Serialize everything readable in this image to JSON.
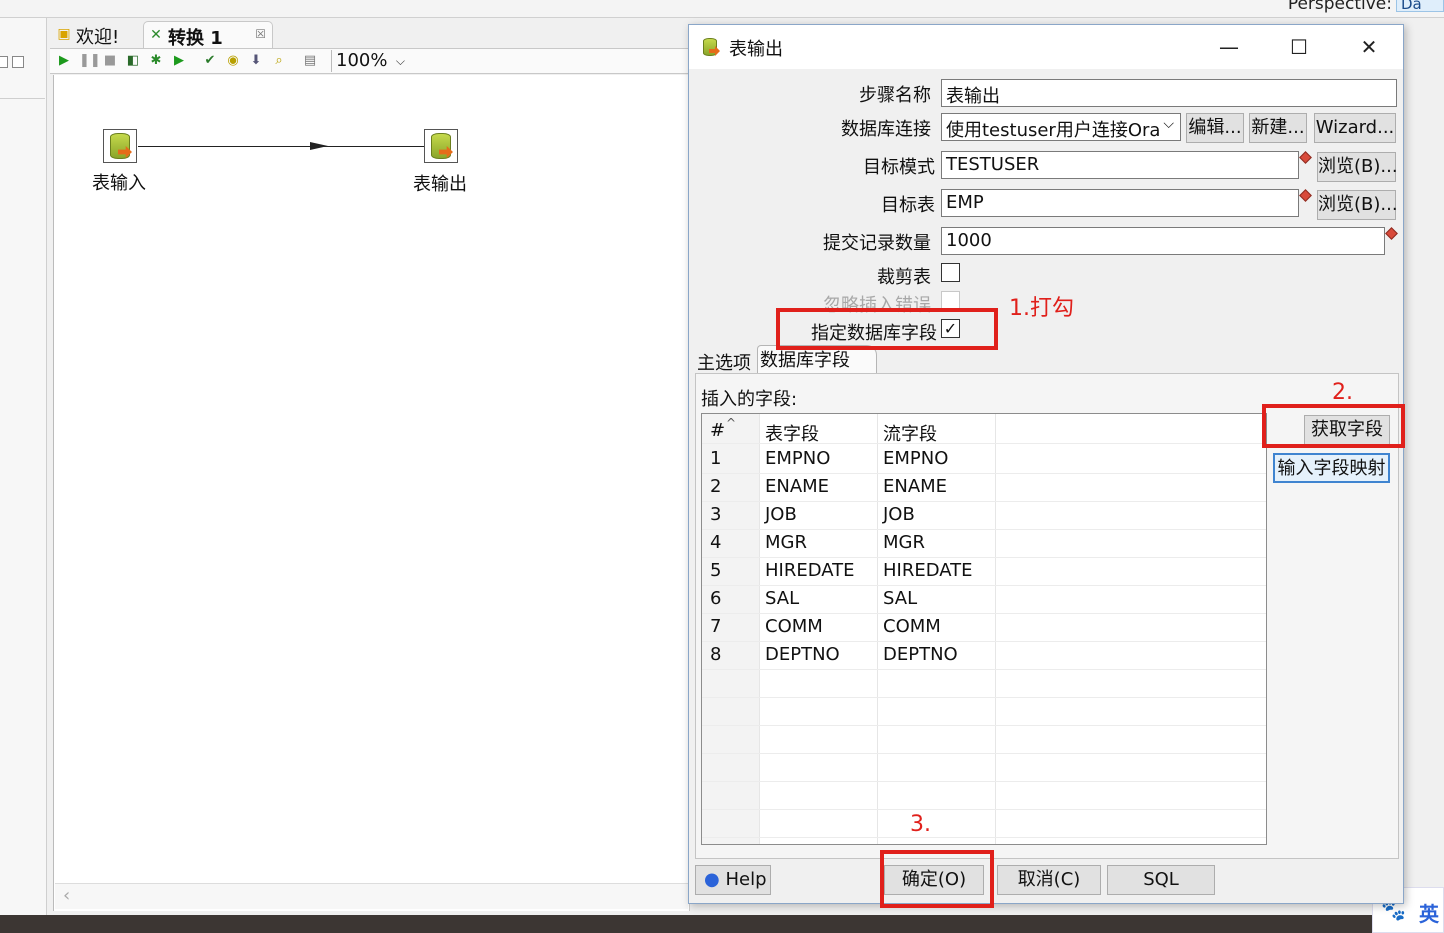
{
  "perspective": {
    "label": "Perspective:",
    "button": "Da"
  },
  "tabs": [
    {
      "label": "欢迎!",
      "icon": "welcome-icon"
    },
    {
      "label": "转换 1",
      "icon": "transformation-icon",
      "close": "☒"
    }
  ],
  "toolbar": {
    "zoom": "100%"
  },
  "canvas": {
    "steps": [
      {
        "label": "表输入",
        "icon": "table-input-icon"
      },
      {
        "label": "表输出",
        "icon": "table-output-icon"
      }
    ]
  },
  "dialog": {
    "title": "表输出",
    "window_controls": {
      "minimize": "—",
      "maximize": "☐",
      "close": "✕"
    },
    "step_name": {
      "label": "步骤名称",
      "value": "表输出"
    },
    "connection": {
      "label": "数据库连接",
      "value": "使用testuser用户连接Ora",
      "edit": "编辑...",
      "new": "新建...",
      "wizard": "Wizard..."
    },
    "target_schema": {
      "label": "目标模式",
      "value": "TESTUSER",
      "browse": "浏览(B)..."
    },
    "target_table": {
      "label": "目标表",
      "value": "EMP",
      "browse": "浏览(B)..."
    },
    "commit_size": {
      "label": "提交记录数量",
      "value": "1000"
    },
    "truncate": {
      "label": "裁剪表",
      "checked": false
    },
    "ignore_errors": {
      "label": "忽略插入错误",
      "checked": false,
      "enabled": false
    },
    "specify_fields": {
      "label": "指定数据库字段",
      "checked": true,
      "mark": "✓"
    },
    "tabs": {
      "main": "主选项",
      "fields": "数据库字段"
    },
    "fields_section": {
      "label": "插入的字段:",
      "columns": [
        "#",
        "表字段",
        "流字段"
      ],
      "rows": [
        [
          "1",
          "EMPNO",
          "EMPNO"
        ],
        [
          "2",
          "ENAME",
          "ENAME"
        ],
        [
          "3",
          "JOB",
          "JOB"
        ],
        [
          "4",
          "MGR",
          "MGR"
        ],
        [
          "5",
          "HIREDATE",
          "HIREDATE"
        ],
        [
          "6",
          "SAL",
          "SAL"
        ],
        [
          "7",
          "COMM",
          "COMM"
        ],
        [
          "8",
          "DEPTNO",
          "DEPTNO"
        ]
      ],
      "get_fields": "获取字段",
      "enter_mapping": "输入字段映射"
    },
    "buttons": {
      "help": "Help",
      "ok": "确定(O)",
      "cancel": "取消(C)",
      "sql": "SQL"
    }
  },
  "annotations": {
    "step1": "1.打勾",
    "step2": "2.",
    "step3": "3."
  },
  "ime": {
    "lang": "英"
  },
  "colors": {
    "annotation": "#e0201b",
    "step_icon_green": "#8aa52a",
    "step_icon_arrow": "#e56c1a"
  }
}
